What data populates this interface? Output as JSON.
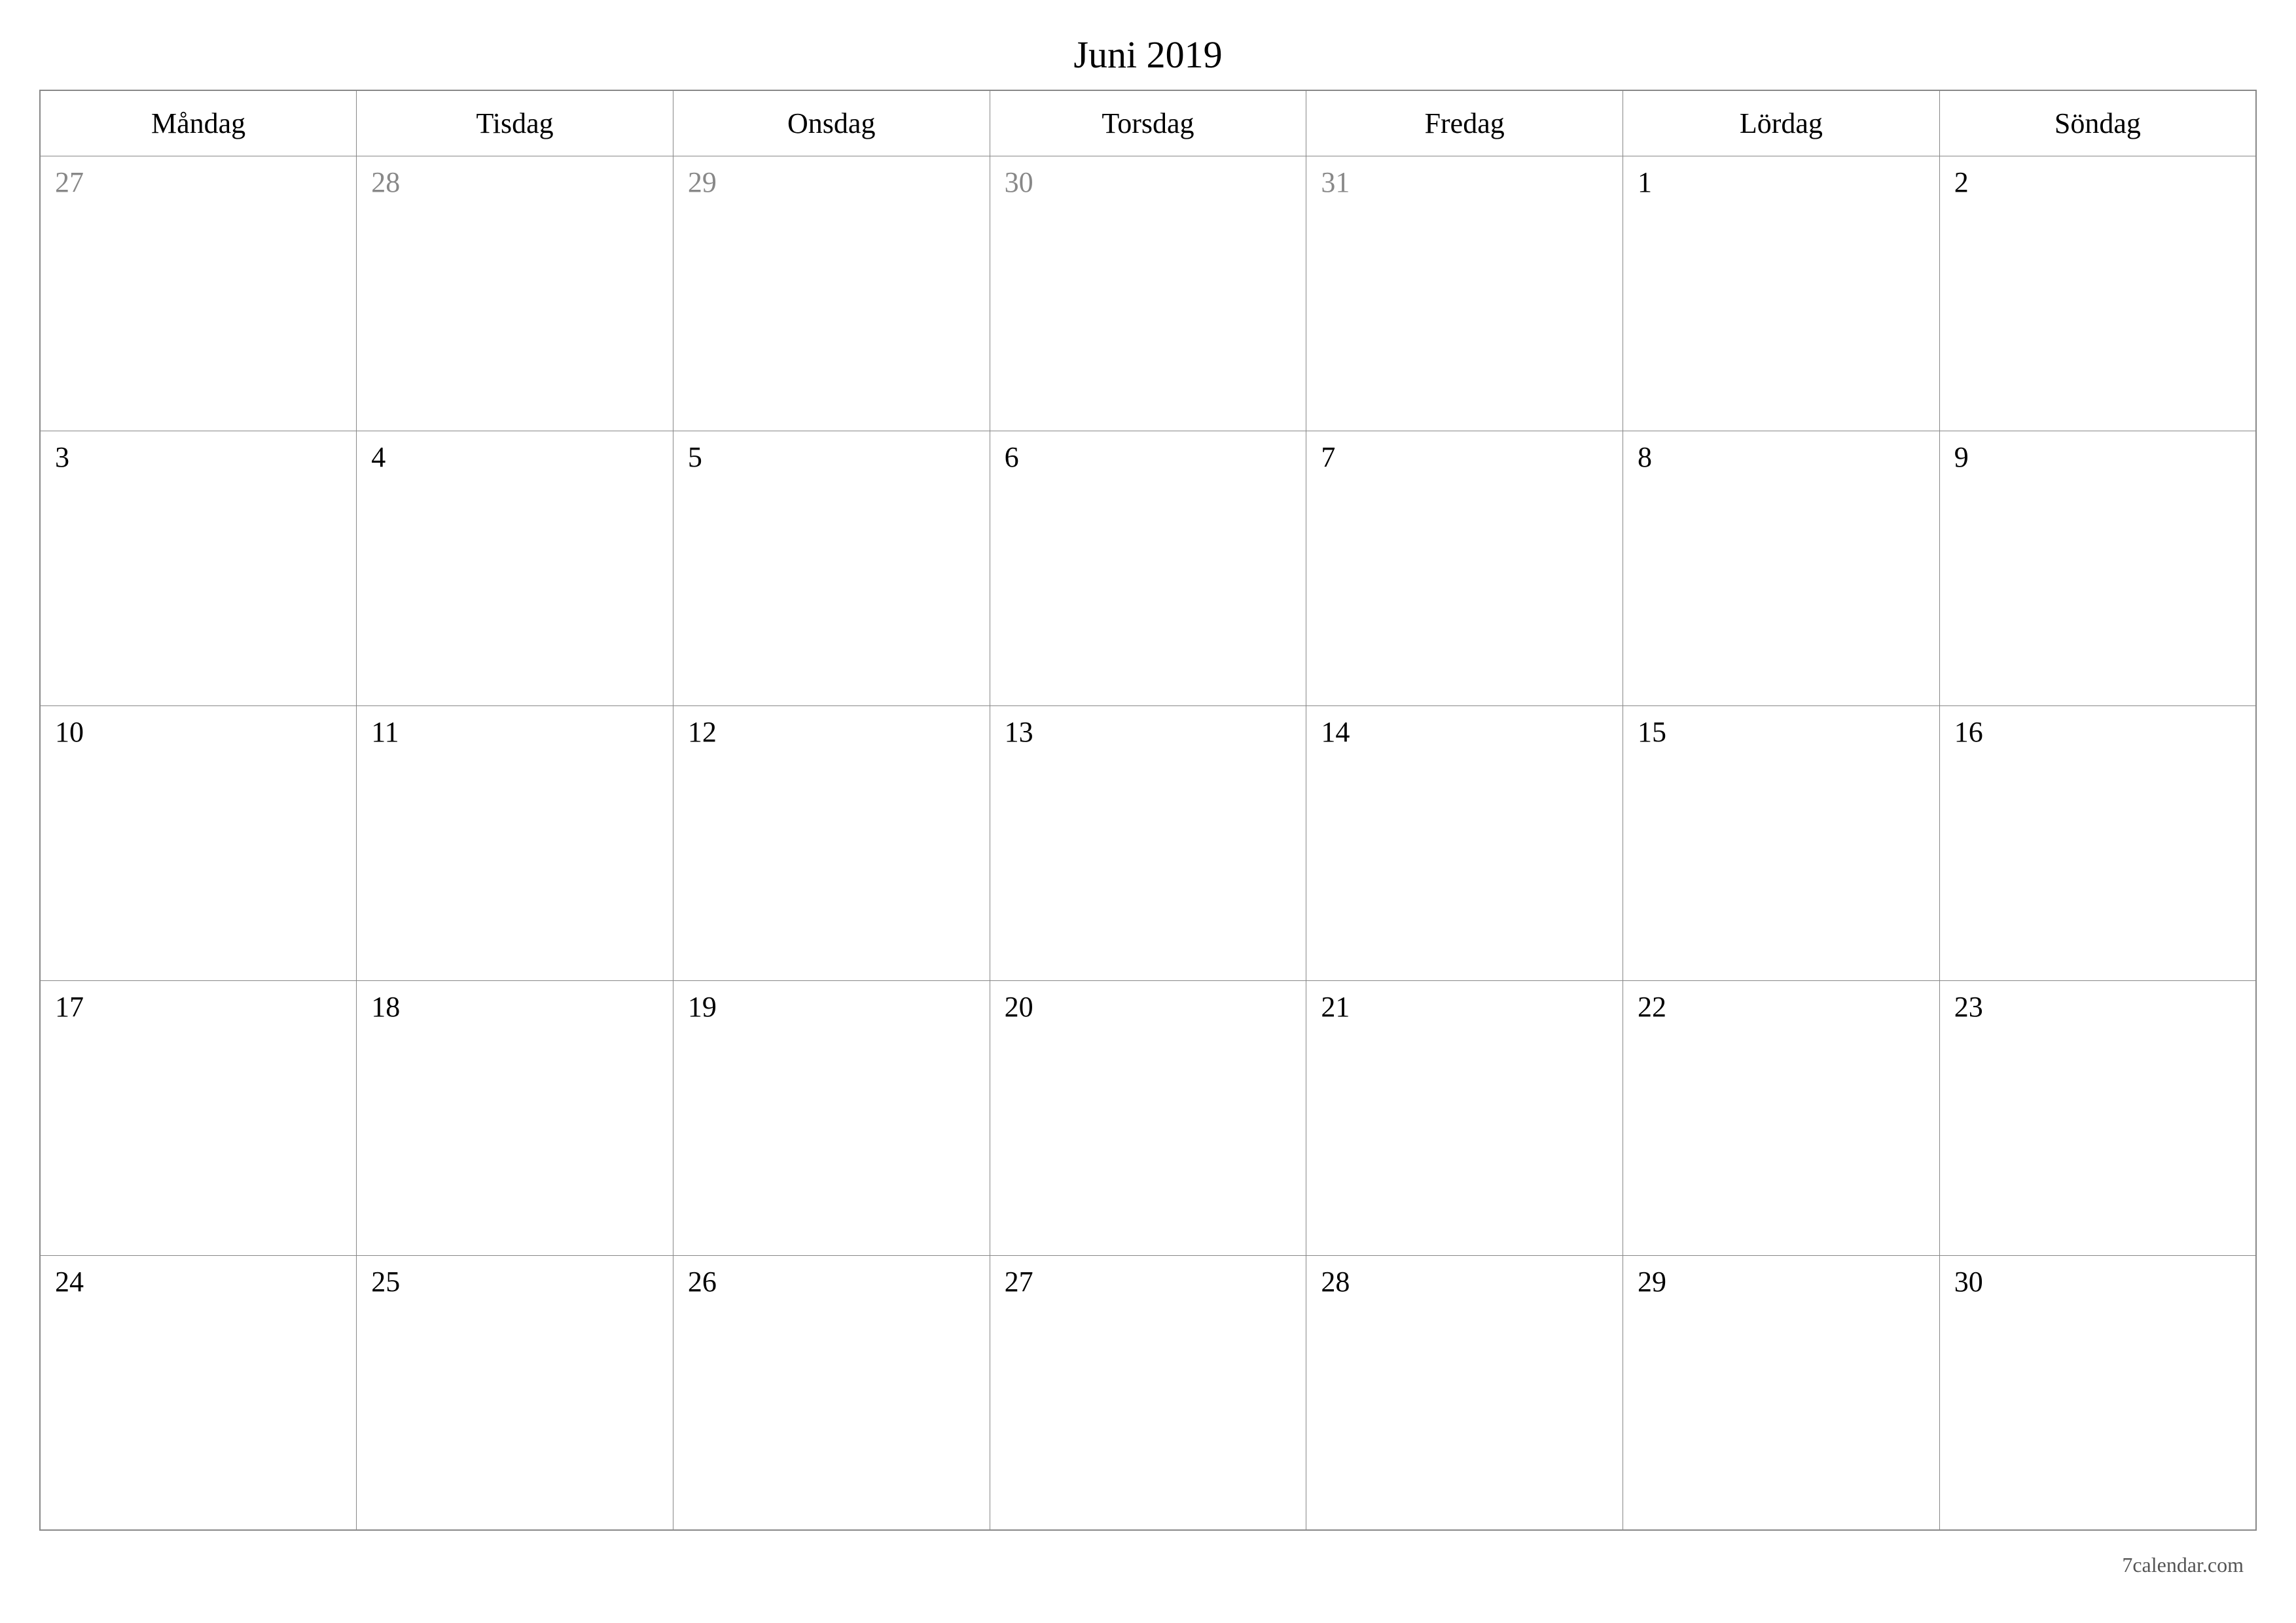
{
  "title": "Juni 2019",
  "weekdays": [
    "Måndag",
    "Tisdag",
    "Onsdag",
    "Torsdag",
    "Fredag",
    "Lördag",
    "Söndag"
  ],
  "weeks": [
    [
      {
        "day": "27",
        "other": true
      },
      {
        "day": "28",
        "other": true
      },
      {
        "day": "29",
        "other": true
      },
      {
        "day": "30",
        "other": true
      },
      {
        "day": "31",
        "other": true
      },
      {
        "day": "1",
        "other": false
      },
      {
        "day": "2",
        "other": false
      }
    ],
    [
      {
        "day": "3",
        "other": false
      },
      {
        "day": "4",
        "other": false
      },
      {
        "day": "5",
        "other": false
      },
      {
        "day": "6",
        "other": false
      },
      {
        "day": "7",
        "other": false
      },
      {
        "day": "8",
        "other": false
      },
      {
        "day": "9",
        "other": false
      }
    ],
    [
      {
        "day": "10",
        "other": false
      },
      {
        "day": "11",
        "other": false
      },
      {
        "day": "12",
        "other": false
      },
      {
        "day": "13",
        "other": false
      },
      {
        "day": "14",
        "other": false
      },
      {
        "day": "15",
        "other": false
      },
      {
        "day": "16",
        "other": false
      }
    ],
    [
      {
        "day": "17",
        "other": false
      },
      {
        "day": "18",
        "other": false
      },
      {
        "day": "19",
        "other": false
      },
      {
        "day": "20",
        "other": false
      },
      {
        "day": "21",
        "other": false
      },
      {
        "day": "22",
        "other": false
      },
      {
        "day": "23",
        "other": false
      }
    ],
    [
      {
        "day": "24",
        "other": false
      },
      {
        "day": "25",
        "other": false
      },
      {
        "day": "26",
        "other": false
      },
      {
        "day": "27",
        "other": false
      },
      {
        "day": "28",
        "other": false
      },
      {
        "day": "29",
        "other": false
      },
      {
        "day": "30",
        "other": false
      }
    ]
  ],
  "footer": "7calendar.com"
}
